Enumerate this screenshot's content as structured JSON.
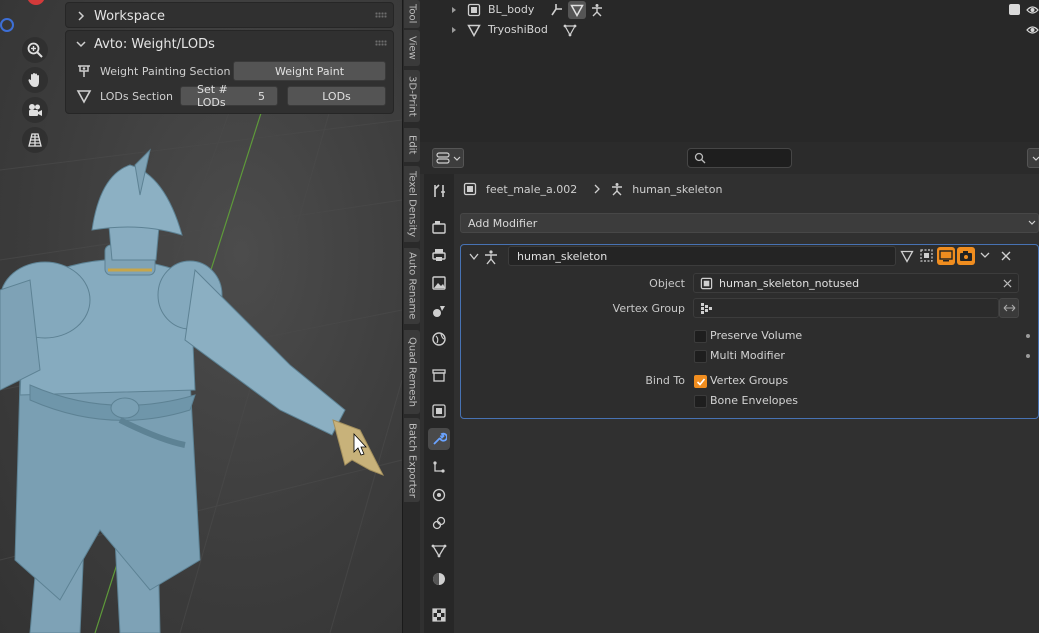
{
  "viewport": {
    "workspace_panel": {
      "title": "Workspace"
    },
    "avto_panel": {
      "title": "Avto: Weight/LODs",
      "weight_section_label": "Weight Painting Section",
      "weight_paint_button": "Weight Paint",
      "lods_section_label": "LODs Section",
      "set_lods_label": "Set # LODs",
      "set_lods_value": "5",
      "lods_button": "LODs"
    }
  },
  "sidebar_tabs": [
    "Tool",
    "View",
    "3D-Print",
    "Edit",
    "Texel Density",
    "Auto Rename",
    "Quad Remesh",
    "Batch Exporter"
  ],
  "outliner": {
    "rows": [
      {
        "name": "BL_body"
      },
      {
        "name": "TryoshiBod"
      }
    ]
  },
  "properties": {
    "breadcrumb": {
      "object": "feet_male_a.002",
      "modifier": "human_skeleton"
    },
    "add_modifier_label": "Add Modifier",
    "modifier": {
      "name": "human_skeleton",
      "object_label": "Object",
      "object_value": "human_skeleton_notused",
      "vertex_group_label": "Vertex Group",
      "vertex_group_value": "",
      "preserve_volume_label": "Preserve Volume",
      "preserve_volume_checked": false,
      "multi_modifier_label": "Multi Modifier",
      "multi_modifier_checked": false,
      "bind_to_label": "Bind To",
      "vertex_groups_label": "Vertex Groups",
      "vertex_groups_checked": true,
      "bone_envelopes_label": "Bone Envelopes",
      "bone_envelopes_checked": false
    }
  },
  "colors": {
    "accent": "#f08d1f",
    "active_outline": "#4772b3",
    "panel": "#303030"
  }
}
